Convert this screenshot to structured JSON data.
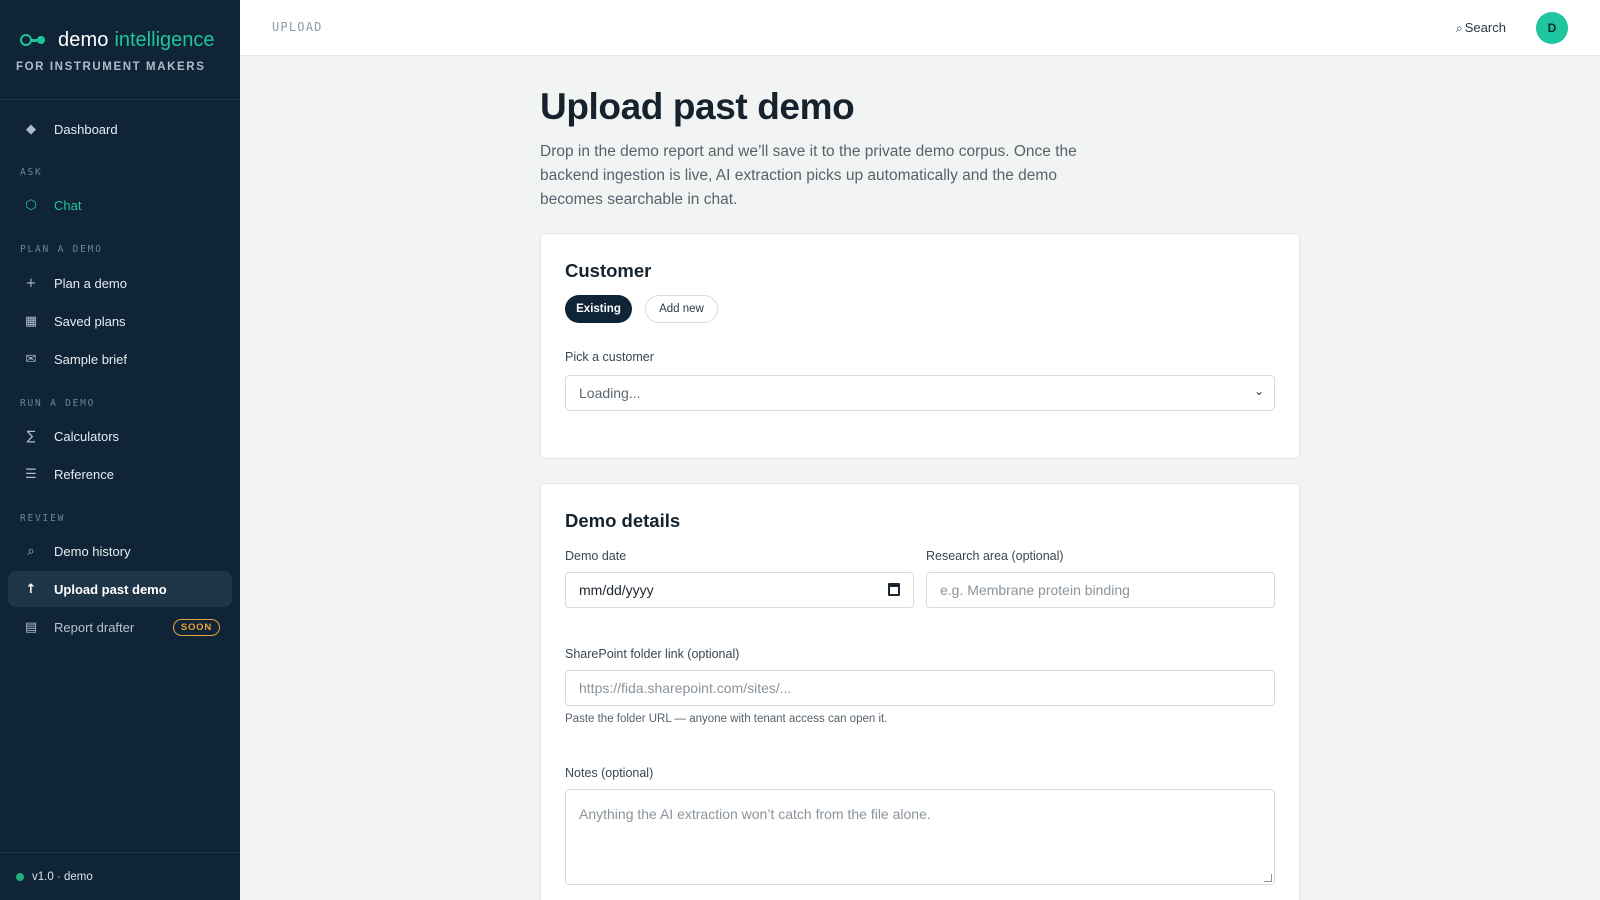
{
  "brand": {
    "name": "demo",
    "accent": "intelligence",
    "subtitle": "FOR INSTRUMENT MAKERS"
  },
  "nav": {
    "dashboard": "Dashboard",
    "sections": {
      "ask": "ASK",
      "plan": "PLAN A DEMO",
      "run": "RUN A DEMO",
      "review": "REVIEW"
    },
    "chat": "Chat",
    "plan_a_demo": "Plan a demo",
    "saved_plans": "Saved plans",
    "sample_brief": "Sample brief",
    "calculators": "Calculators",
    "reference": "Reference",
    "demo_history": "Demo history",
    "upload_past_demo": "Upload past demo",
    "report_drafter": "Report drafter",
    "soon_badge": "SOON",
    "icons": {
      "dashboard": "diamond-icon",
      "chat": "hexagon-icon",
      "plan": "plus-icon",
      "saved": "grid-icon",
      "sample": "envelope-icon",
      "calculators": "sigma-icon",
      "reference": "list-icon",
      "history": "search-icon",
      "upload": "arrow-up-icon",
      "drafter": "document-icon"
    }
  },
  "footer": {
    "version": "v1.0 · demo"
  },
  "topbar": {
    "breadcrumb": "UPLOAD",
    "search": "Search",
    "avatar": "D"
  },
  "page": {
    "title": "Upload past demo",
    "description": "Drop in the demo report and we’ll save it to the private demo corpus. Once the backend ingestion is live, AI extraction picks up automatically and the demo becomes searchable in chat."
  },
  "customer": {
    "title": "Customer",
    "mode_existing": "Existing",
    "mode_add_new": "Add new",
    "selected_mode": "Existing",
    "pick_label": "Pick a customer",
    "pick_value": "Loading..."
  },
  "details": {
    "title": "Demo details",
    "date_label": "Demo date",
    "date_placeholder": "mm/dd/yyyy",
    "research_label": "Research area (optional)",
    "research_placeholder": "e.g. Membrane protein binding",
    "sharepoint_label": "SharePoint folder link (optional)",
    "sharepoint_placeholder": "https://fida.sharepoint.com/sites/...",
    "sharepoint_help": "Paste the folder URL — anyone with tenant access can open it.",
    "notes_label": "Notes (optional)",
    "notes_placeholder": "Anything the AI extraction won’t catch from the file alone."
  },
  "colors": {
    "sidebar_bg": "#0f2436",
    "accent": "#1fc59c",
    "soon": "#e8a33a",
    "page_bg": "#f1f4f3"
  }
}
